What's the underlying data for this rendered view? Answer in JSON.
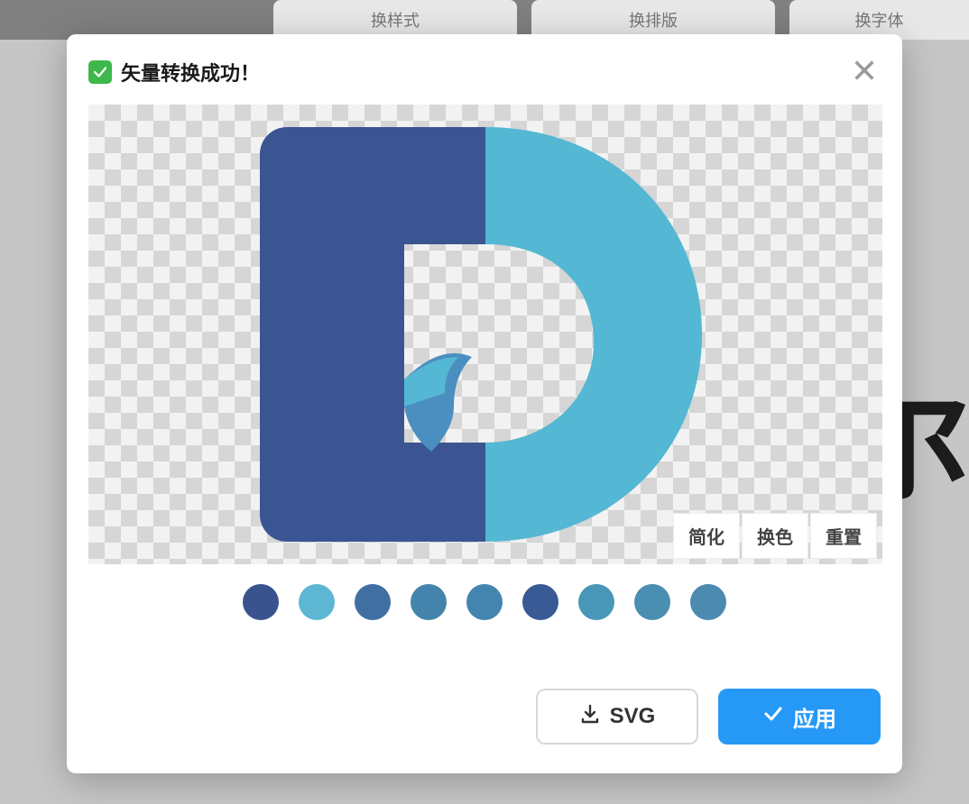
{
  "background": {
    "tabs": [
      {
        "label": "换样式"
      },
      {
        "label": "换排版"
      },
      {
        "label": "换字体"
      }
    ],
    "letter_fragment": "尔"
  },
  "modal": {
    "title": "矢量转换成功！",
    "success_icon": "check-icon",
    "close_icon": "close-icon",
    "preview": {
      "tools": {
        "simplify": "简化",
        "recolor": "换色",
        "reset": "重置"
      },
      "logo_colors": {
        "left": "#3a5591",
        "right": "#54b7d3"
      }
    },
    "swatches": [
      "#39538f",
      "#5db6d2",
      "#3f6fa3",
      "#4484ac",
      "#4385af",
      "#3a5a96",
      "#4897b8",
      "#4a8fb1",
      "#4d8ab0"
    ],
    "footer": {
      "download_label": "SVG",
      "apply_label": "应用"
    }
  }
}
